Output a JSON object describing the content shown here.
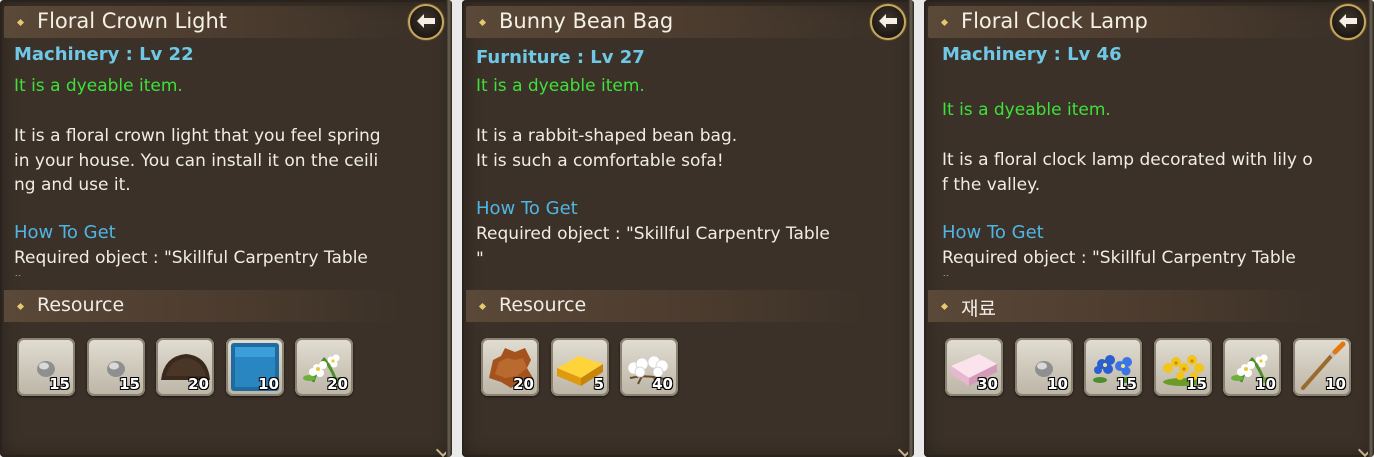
{
  "panels": [
    {
      "title": "Floral Crown Light",
      "category": "Machinery : Lv 22",
      "dyeable": "It is a dyeable item.",
      "description": "It is a floral crown light that you feel spring\nin your house. You can install it on the ceili\nng and use it.",
      "how_to_get_label": "How To Get",
      "required": "Required object : \"Skillful Carpentry Table\n\"",
      "resource_label": "Resource",
      "resources": [
        {
          "icon": "stone-icon",
          "qty": "15"
        },
        {
          "icon": "stone-icon",
          "qty": "15"
        },
        {
          "icon": "soil-pile-icon",
          "qty": "20"
        },
        {
          "icon": "blue-cube-icon",
          "qty": "10"
        },
        {
          "icon": "white-flower-icon",
          "qty": "20"
        }
      ]
    },
    {
      "title": "Bunny Bean Bag",
      "category": "Furniture : Lv 27",
      "dyeable": "It is a dyeable item.",
      "description": "It is a rabbit-shaped bean bag.\nIt is such a comfortable sofa!",
      "how_to_get_label": "How To Get",
      "required": "Required object : \"Skillful Carpentry Table\n\"",
      "resource_label": "Resource",
      "resources": [
        {
          "icon": "leather-icon",
          "qty": "20"
        },
        {
          "icon": "yellow-sponge-icon",
          "qty": "5"
        },
        {
          "icon": "cotton-icon",
          "qty": "40"
        }
      ]
    },
    {
      "title": "Floral Clock Lamp",
      "category": "Machinery : Lv 46",
      "dyeable": "It is a dyeable item.",
      "description": "It is a floral clock lamp decorated with lily o\nf the valley.",
      "how_to_get_label": "How To Get",
      "required": "Required object : \"Skillful Carpentry Table\n\"",
      "resource_label": "재료",
      "resources": [
        {
          "icon": "pink-eraser-icon",
          "qty": "30"
        },
        {
          "icon": "stone-icon",
          "qty": "10"
        },
        {
          "icon": "blue-flower-icon",
          "qty": "15"
        },
        {
          "icon": "yellow-flower-icon",
          "qty": "15"
        },
        {
          "icon": "white-flower-icon",
          "qty": "10"
        },
        {
          "icon": "brush-icon",
          "qty": "10"
        }
      ]
    }
  ],
  "colors": {
    "panel_bg": "#3b3128",
    "category": "#6fc9e6",
    "dyeable": "#3fe03a",
    "how_to_get": "#4fb6e3",
    "text": "#f1ede4",
    "accent_gold": "#c9a85e"
  }
}
